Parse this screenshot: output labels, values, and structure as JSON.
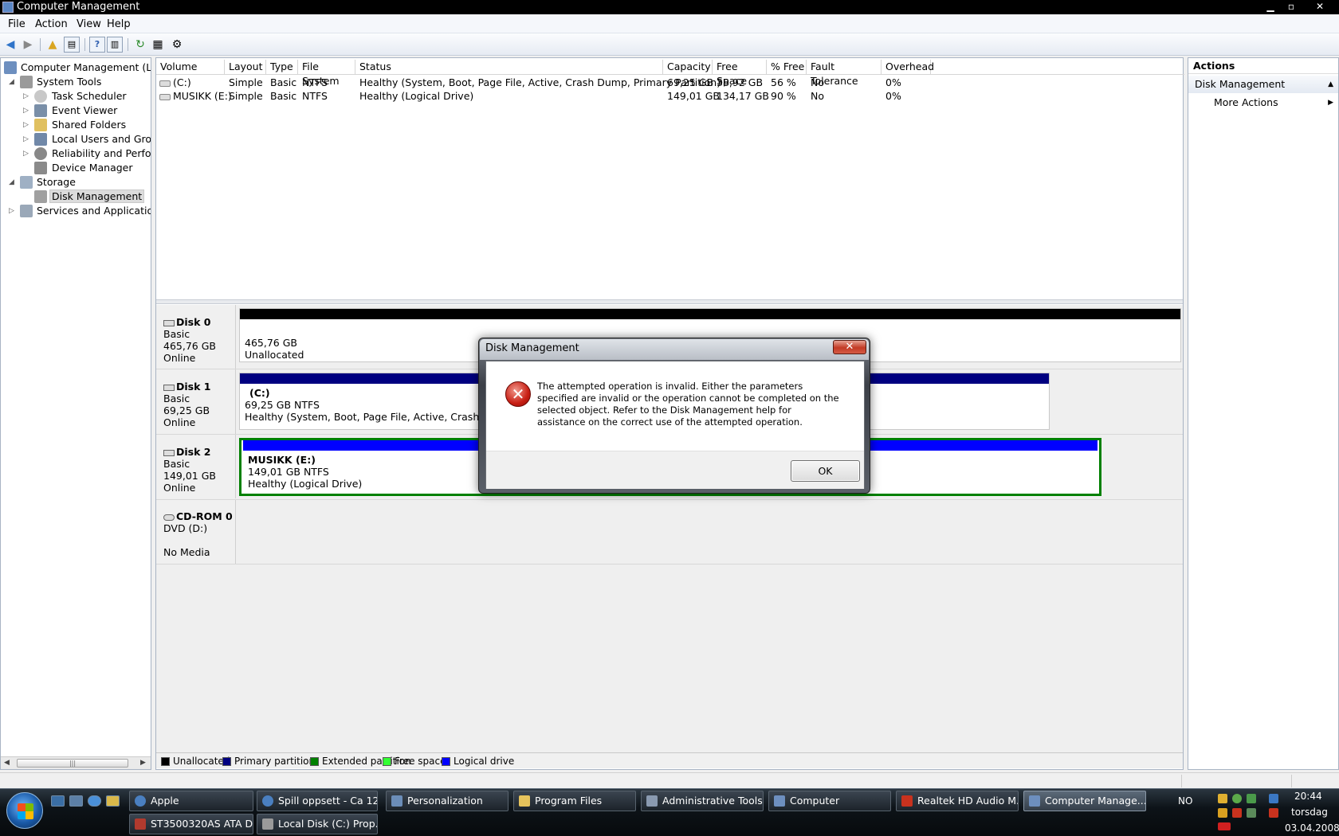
{
  "window": {
    "title": "Computer Management",
    "minimize": "▁",
    "maximize": "▫",
    "close": "✕"
  },
  "menu": [
    "File",
    "Action",
    "View",
    "Help"
  ],
  "tree": {
    "root": "Computer Management (Local",
    "system_tools": "System Tools",
    "task_scheduler": "Task Scheduler",
    "event_viewer": "Event Viewer",
    "shared_folders": "Shared Folders",
    "local_users": "Local Users and Groups",
    "reliability": "Reliability and Performa",
    "device_manager": "Device Manager",
    "storage": "Storage",
    "disk_management": "Disk Management",
    "services": "Services and Applications"
  },
  "volumes": {
    "columns": [
      "Volume",
      "Layout",
      "Type",
      "File System",
      "Status",
      "Capacity",
      "Free Space",
      "% Free",
      "Fault Tolerance",
      "Overhead"
    ],
    "rows": [
      [
        "(C:)",
        "Simple",
        "Basic",
        "NTFS",
        "Healthy (System, Boot, Page File, Active, Crash Dump, Primary Partition)",
        "69,25 GB",
        "38,92 GB",
        "56 %",
        "No",
        "0%"
      ],
      [
        "MUSIKK (E:)",
        "Simple",
        "Basic",
        "NTFS",
        "Healthy (Logical Drive)",
        "149,01 GB",
        "134,17 GB",
        "90 %",
        "No",
        "0%"
      ]
    ]
  },
  "disks": [
    {
      "name": "Disk 0",
      "type": "Basic",
      "size": "465,76 GB",
      "state": "Online",
      "part": {
        "name": "",
        "size": "465,76 GB",
        "status": "Unallocated"
      }
    },
    {
      "name": "Disk 1",
      "type": "Basic",
      "size": "69,25 GB",
      "state": "Online",
      "part": {
        "name": "(C:)",
        "size": "69,25 GB NTFS",
        "status": "Healthy (System, Boot, Page File, Active, Crash Dump, P"
      }
    },
    {
      "name": "Disk 2",
      "type": "Basic",
      "size": "149,01 GB",
      "state": "Online",
      "part": {
        "name": "MUSIKK  (E:)",
        "size": "149,01 GB NTFS",
        "status": "Healthy (Logical Drive)"
      }
    },
    {
      "name": "CD-ROM 0",
      "type": "DVD (D:)",
      "size": "",
      "state": "No Media"
    }
  ],
  "legend": [
    {
      "label": "Unallocated",
      "color": "#000000"
    },
    {
      "label": "Primary partition",
      "color": "#000080"
    },
    {
      "label": "Extended partition",
      "color": "#008000"
    },
    {
      "label": "Free space",
      "color": "#33ff33"
    },
    {
      "label": "Logical drive",
      "color": "#0000ff"
    }
  ],
  "actions": {
    "header": "Actions",
    "section": "Disk Management",
    "more": "More Actions"
  },
  "dialog": {
    "title": "Disk Management",
    "close": "✕",
    "message": "The attempted operation is invalid.  Either the parameters specified are invalid or the operation cannot be completed on the selected object.  Refer to the Disk Management help for assistance on the correct use of the attempted operation.",
    "ok": "OK"
  },
  "taskbar": {
    "tasks": [
      "Apple",
      "Spill oppsett - Ca 12...",
      "Personalization",
      "Program Files",
      "Administrative Tools",
      "Computer",
      "Realtek HD Audio M...",
      "Computer Manage...",
      "ST3500320AS ATA D...",
      "Local Disk (C:) Prop..."
    ],
    "lang": "NO",
    "time": "20:44",
    "day": "torsdag",
    "date": "03.04.2008"
  }
}
